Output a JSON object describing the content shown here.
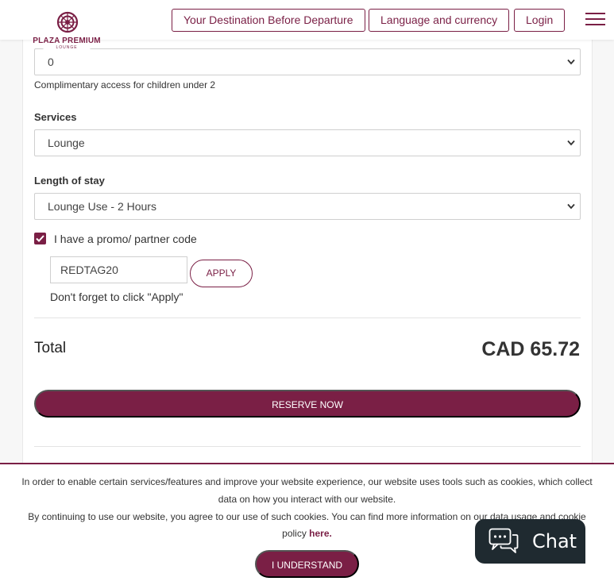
{
  "header": {
    "brand": "PLAZA PREMIUM",
    "brand_sub": "LOUNGE",
    "nav": [
      "Your Destination Before Departure",
      "Language and currency",
      "Login"
    ]
  },
  "form": {
    "children_value": "0",
    "children_helper": "Complimentary access for children under 2",
    "services_label": "Services",
    "services_value": "Lounge",
    "stay_label": "Length of stay",
    "stay_value": "Lounge Use - 2 Hours",
    "promo_checkbox_label": "I have a promo/ partner code",
    "promo_checked": true,
    "promo_value": "REDTAG20",
    "apply_label": "APPLY",
    "reminder": "Don't forget to click \"Apply\""
  },
  "summary": {
    "total_label": "Total",
    "total_value": "CAD 65.72",
    "reserve_label": "RESERVE NOW"
  },
  "cookie": {
    "line1": "In order to enable certain services/features and improve your website experience, our website uses tools such as cookies, which collect",
    "line2": "data on how you interact with our website.",
    "line3": "By continuing to use our website, you agree to our use of such cookies. You can find more information on our data usage and cookie",
    "line4_prefix": "policy ",
    "line4_link": "here.",
    "button": "I UNDERSTAND"
  },
  "chat": {
    "label": "Chat"
  },
  "colors": {
    "brand": "#7a1f45",
    "chat_bg": "#1f2a30"
  }
}
